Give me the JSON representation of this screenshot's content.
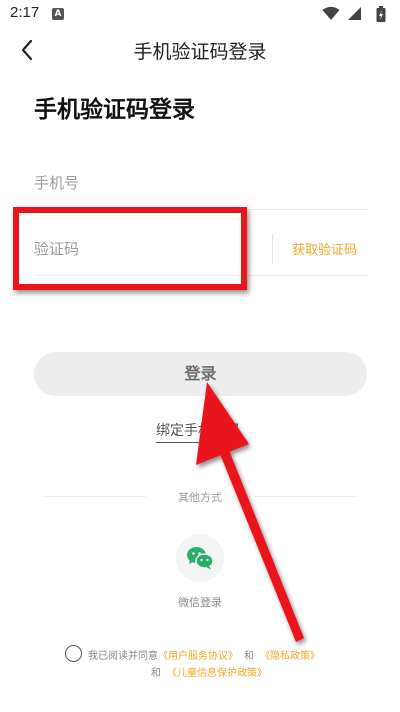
{
  "status_bar": {
    "time": "2:17",
    "notification_letter": "A"
  },
  "header": {
    "title": "手机验证码登录"
  },
  "page_title": "手机验证码登录",
  "form": {
    "phone_placeholder": "手机号",
    "code_placeholder": "验证码",
    "get_code_label": "获取验证码"
  },
  "login_button_label": "登录",
  "bind_phone_label": "绑定手机号码",
  "other_methods": {
    "label": "其他方式",
    "wechat_label": "微信登录"
  },
  "agreement": {
    "prefix": "我已阅读并同意",
    "user_agreement": "《用户服务协议》",
    "and1": "和",
    "privacy_policy": "《隐私政策》",
    "and2": "和",
    "children_policy": "《儿童信息保护政策》"
  },
  "colors": {
    "accent": "#f5a623",
    "annotation_red": "#e8151b",
    "wechat_green": "#2aae67",
    "button_bg": "#ededed"
  }
}
